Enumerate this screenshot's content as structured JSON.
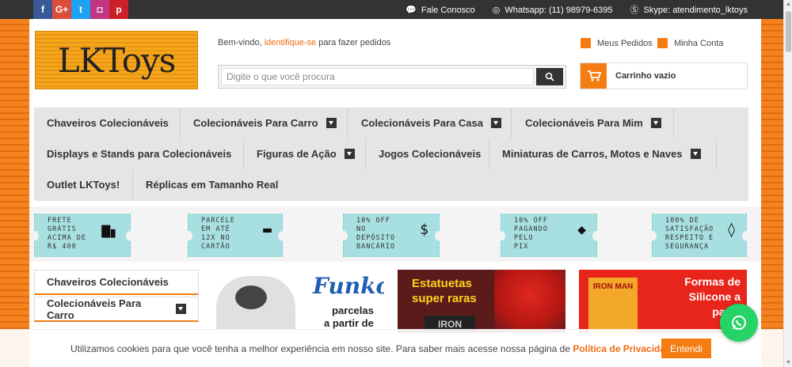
{
  "topbar": {
    "social": [
      {
        "icon": "facebook-icon",
        "glyph": "f",
        "color": "#3b5998"
      },
      {
        "icon": "google-plus-icon",
        "glyph": "G+",
        "color": "#dd4b39"
      },
      {
        "icon": "twitter-icon",
        "glyph": "t",
        "color": "#1da1f2"
      },
      {
        "icon": "instagram-icon",
        "glyph": "◘",
        "color": "#c13584"
      },
      {
        "icon": "pinterest-icon",
        "glyph": "p",
        "color": "#cb2027"
      }
    ],
    "contact": "Fale Conosco",
    "whatsapp": "Whatsapp: (11) 98979-6395",
    "skype": "Skype: atendimento_lktoys"
  },
  "header": {
    "logo": "LKToys",
    "welcome_prefix": "Bem-vindo, ",
    "welcome_link": "identifique-se",
    "welcome_suffix": " para fazer pedidos",
    "search_placeholder": "Digite o que você procura",
    "orders": "Meus Pedidos",
    "account": "Minha Conta",
    "cart": "Carrinho vazio"
  },
  "nav": {
    "items": [
      {
        "label": "Chaveiros Colecionáveis"
      },
      {
        "label": "Colecionáveis Para Carro"
      },
      {
        "label": "Colecionáveis Para Casa"
      },
      {
        "label": "Colecionáveis Para Mim"
      },
      {
        "label": "Displays e Stands para Colecionáveis"
      },
      {
        "label": "Figuras de Ação"
      },
      {
        "label": "Jogos Colecionáveis"
      },
      {
        "label": "Miniaturas de Carros, Motos e Naves"
      },
      {
        "label": "Outlet LKToys!"
      },
      {
        "label": "Réplicas em Tamanho Real"
      }
    ]
  },
  "benefits": [
    {
      "lines": [
        "Frete",
        "grátis",
        "acima de",
        "R$ 400"
      ],
      "icon": "truck-icon"
    },
    {
      "lines": [
        "Parcele",
        "em até",
        "12x no",
        "cartão"
      ],
      "icon": "credit-card-icon"
    },
    {
      "lines": [
        "10% off",
        "no",
        "depósito",
        "bancário"
      ],
      "icon": "money-hand-icon"
    },
    {
      "lines": [
        "10% off",
        "pagando",
        "pelo",
        "pix"
      ],
      "icon": "pix-icon"
    },
    {
      "lines": [
        "100% de",
        "satisfação",
        "respeito e",
        "segurança"
      ],
      "icon": "shopping-bag-icon"
    }
  ],
  "sidebar": {
    "items": [
      "Chaveiros Colecionáveis",
      "Colecionáveis Para Carro"
    ]
  },
  "banners": {
    "b1_brand": "Funko",
    "b1_text": "parcelas\na partir de",
    "b2_text": "Estatuetas\nsuper raras",
    "b2_sub": "IRON",
    "b3_text": "Formas de\nSilicone a\npartir",
    "b3_sub": "IRON MAN"
  },
  "cookie": {
    "text": "Utilizamos cookies para que você tenha a melhor experiência em nosso site. Para saber mais acesse nossa página de ",
    "link": "Política de Privacidade",
    "button": "Entendi"
  }
}
